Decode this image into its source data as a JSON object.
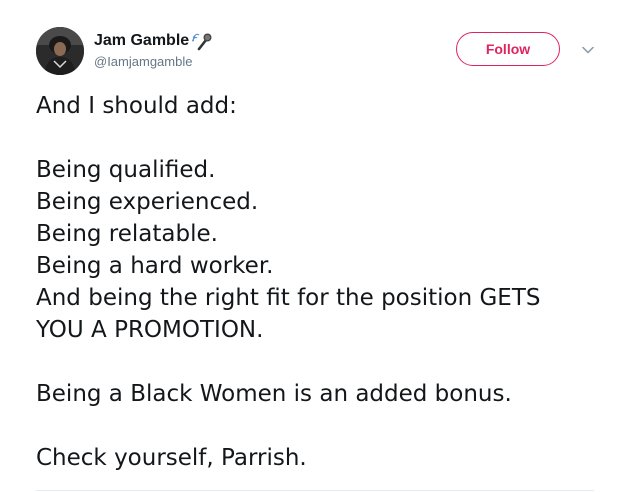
{
  "author": {
    "name": "Jam Gamble",
    "handle": "@Iamjamgamble",
    "name_emoji_icon": "microphone-icon",
    "avatar_icon": "avatar"
  },
  "actions": {
    "follow_label": "Follow",
    "menu_icon": "chevron-down-icon"
  },
  "colors": {
    "follow_accent": "#e0245e",
    "handle_gray": "#657786",
    "text": "#14171a"
  },
  "tweet": {
    "line_1": "And I should add:",
    "line_2": "Being qualified.",
    "line_3": "Being experienced.",
    "line_4": "Being relatable.",
    "line_5": "Being a hard worker.",
    "line_6": "And being the right fit for the position GETS",
    "line_7": "YOU A PROMOTION.",
    "line_8": "Being a Black Women is an added bonus.",
    "line_9": "Check yourself, Parrish."
  }
}
